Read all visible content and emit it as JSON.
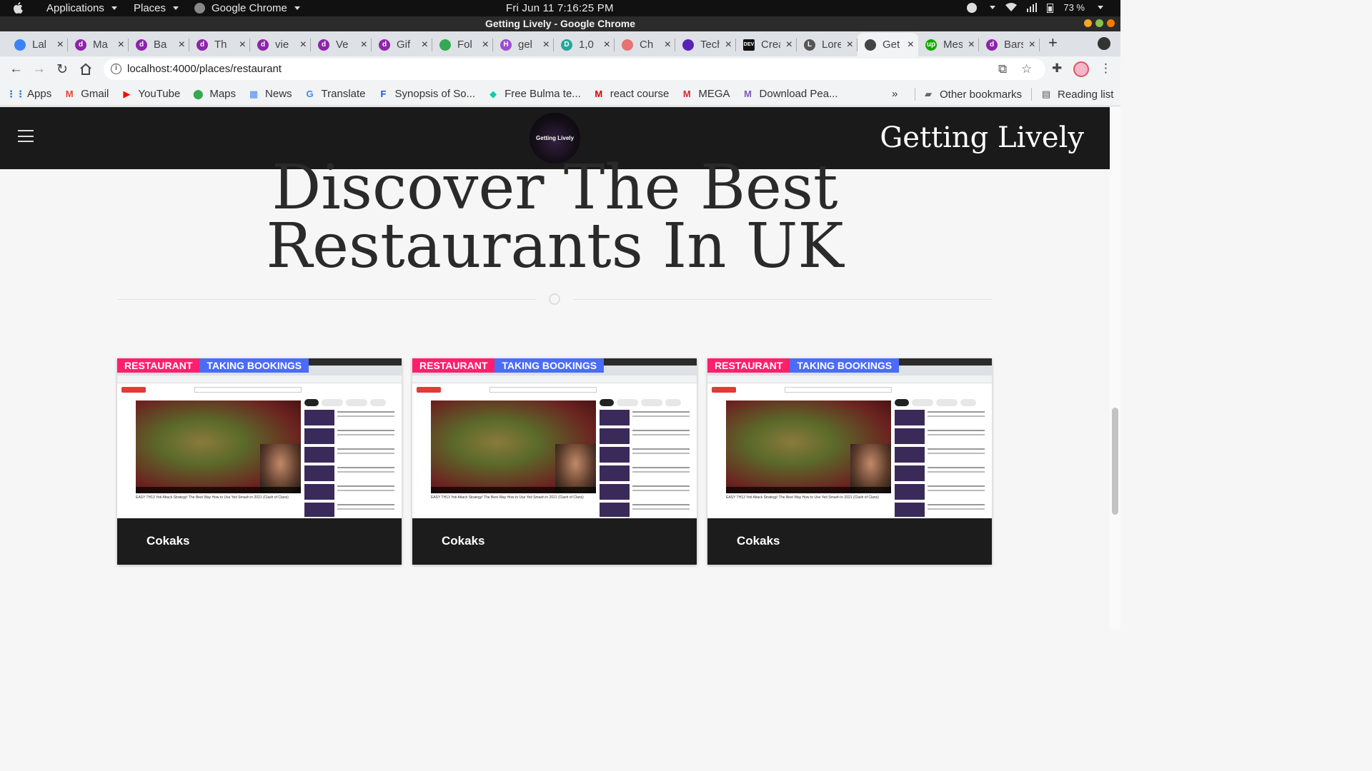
{
  "os_bar": {
    "applications": "Applications",
    "places": "Places",
    "chrome": "Google Chrome",
    "clock": "Fri Jun 11   7:16:25 PM",
    "battery": "73 %"
  },
  "window_title": "Getting Lively - Google Chrome",
  "tabs": [
    {
      "title": "Lal",
      "color": "#3b82f6",
      "glyph": ""
    },
    {
      "title": "Ma",
      "color": "#8e24aa",
      "glyph": "d"
    },
    {
      "title": "Ba",
      "color": "#8e24aa",
      "glyph": "d"
    },
    {
      "title": "Th",
      "color": "#8e24aa",
      "glyph": "d"
    },
    {
      "title": "vie",
      "color": "#8e24aa",
      "glyph": "d"
    },
    {
      "title": "Ve",
      "color": "#8e24aa",
      "glyph": "d"
    },
    {
      "title": "Gif",
      "color": "#8e24aa",
      "glyph": "d"
    },
    {
      "title": "Fol",
      "color": "#34a853",
      "glyph": ""
    },
    {
      "title": "gel",
      "color": "#9c4dcc",
      "glyph": "H"
    },
    {
      "title": "1,0",
      "color": "#26a69a",
      "glyph": "D"
    },
    {
      "title": "Ch",
      "color": "#e57373",
      "glyph": ""
    },
    {
      "title": "Techn",
      "color": "#5b21b6",
      "glyph": ""
    },
    {
      "title": "Creati",
      "color": "#111111",
      "glyph": "DEV"
    },
    {
      "title": "Lorem",
      "color": "#555555",
      "glyph": "L"
    },
    {
      "title": "Get",
      "color": "#444444",
      "glyph": ""
    },
    {
      "title": "Messa",
      "color": "#14a800",
      "glyph": "up"
    },
    {
      "title": "Bars |",
      "color": "#8e24aa",
      "glyph": "d"
    }
  ],
  "url": "localhost:4000/places/restaurant",
  "bookmarks": [
    {
      "label": "Apps",
      "color": "#1a73e8",
      "glyph": "⋮⋮"
    },
    {
      "label": "Gmail",
      "color": "#ea4335",
      "glyph": "M"
    },
    {
      "label": "YouTube",
      "color": "#ff0000",
      "glyph": "▶"
    },
    {
      "label": "Maps",
      "color": "#34a853",
      "glyph": "⬤"
    },
    {
      "label": "News",
      "color": "#4285f4",
      "glyph": "▦"
    },
    {
      "label": "Translate",
      "color": "#4285f4",
      "glyph": "G"
    },
    {
      "label": "Synopsis of So...",
      "color": "#1a56db",
      "glyph": "F"
    },
    {
      "label": "Free Bulma te...",
      "color": "#00d1b2",
      "glyph": "◆"
    },
    {
      "label": "react course",
      "color": "#d50000",
      "glyph": "M"
    },
    {
      "label": "MEGA",
      "color": "#d9272e",
      "glyph": "M"
    },
    {
      "label": "Download Pea...",
      "color": "#7e57c2",
      "glyph": "M"
    }
  ],
  "bookmarks_more": "»",
  "other_bookmarks": "Other bookmarks",
  "reading_list": "Reading list",
  "site": {
    "logo_text": "Getting Lively",
    "brand": "Getting Lively",
    "heading_line1": "Discover The Best",
    "heading_line2": "Restaurants In UK"
  },
  "colors": {
    "tag_restaurant": "#ff1f6d",
    "tag_bookings": "#4a6cf7"
  },
  "cards": [
    {
      "tag1": "RESTAURANT",
      "tag2": "TAKING BOOKINGS",
      "name": "Cokaks",
      "thumb_caption": "EASY TH13 Yeti Attack Strategy! The Best Way How to Use Yeti Smash in 2021 (Clash of Clans)"
    },
    {
      "tag1": "RESTAURANT",
      "tag2": "TAKING BOOKINGS",
      "name": "Cokaks",
      "thumb_caption": "EASY TH13 Yeti Attack Strategy! The Best Way How to Use Yeti Smash in 2021 (Clash of Clans)"
    },
    {
      "tag1": "RESTAURANT",
      "tag2": "TAKING BOOKINGS",
      "name": "Cokaks",
      "thumb_caption": "EASY TH13 Yeti Attack Strategy! The Best Way How to Use Yeti Smash in 2021 (Clash of Clans)"
    }
  ]
}
